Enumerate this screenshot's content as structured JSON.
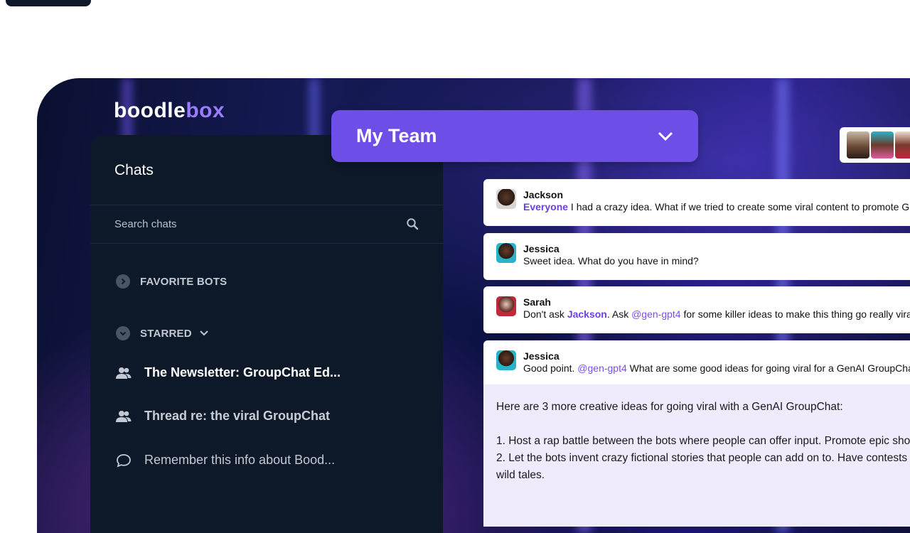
{
  "app": {
    "logo_main": "boodle",
    "logo_accent": "box"
  },
  "sidebar": {
    "title": "Chats",
    "search_placeholder": "Search chats",
    "sections": [
      {
        "label": "FAVORITE BOTS",
        "state": "collapsed"
      },
      {
        "label": "STARRED",
        "state": "expanded"
      }
    ],
    "chats": [
      {
        "label": "The Newsletter: GroupChat Ed...",
        "icon": "group-icon"
      },
      {
        "label": "Thread re: the viral GroupChat",
        "icon": "group-icon"
      },
      {
        "label": "Remember this info about Bood...",
        "icon": "speech-bubble-icon"
      }
    ]
  },
  "team_selector": {
    "label": "My Team"
  },
  "messages": [
    {
      "author": "Jackson",
      "mention": "Everyone",
      "text": " I had a crazy idea. What if we tried to create some viral content to promote Grou"
    },
    {
      "author": "Jessica",
      "text": "Sweet idea. What do you have in mind?"
    },
    {
      "author": "Sarah",
      "pre": "Don't ask ",
      "mention_bold": "Jackson",
      "mid": ". Ask ",
      "mention": "@gen-gpt4",
      "post": " for some killer ideas to make this thing go really viral."
    },
    {
      "author": "Jessica",
      "pre": "Good point. ",
      "mention": "@gen-gpt4",
      "post": " What are some good ideas for going viral for a GenAI GroupChat?"
    }
  ],
  "bot_reply": {
    "text": "Here are 3 more creative ideas for going viral with a GenAI GroupChat:\n\n1. Host a rap battle between the bots where people can offer input. Promote epic sho\n2. Let the bots invent crazy fictional stories that people can add on to. Have contests\nwild tales."
  },
  "colors": {
    "accent": "#6d4ee6",
    "sidebar_bg": "#0d1829",
    "mention": "#7a4fe6",
    "reply_bg": "#efeafc"
  }
}
